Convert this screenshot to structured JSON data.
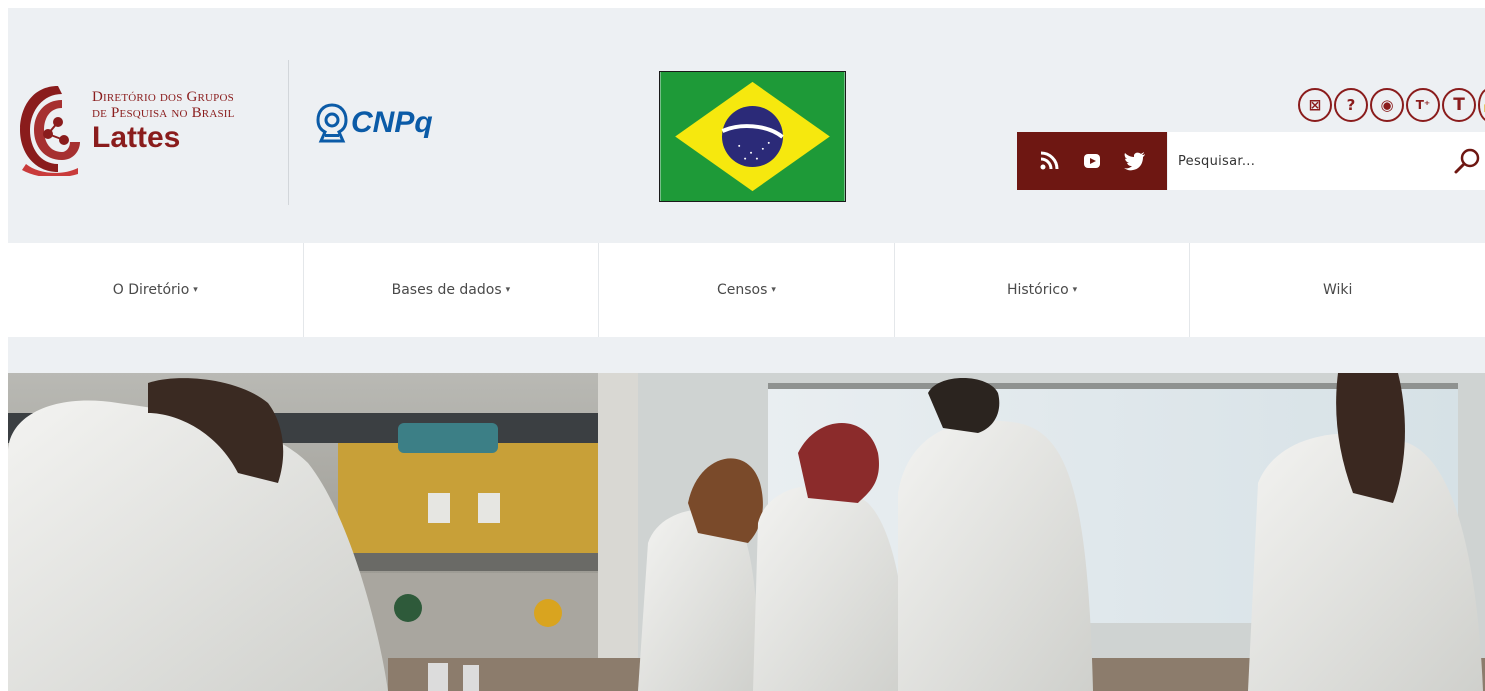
{
  "header": {
    "lattes_logo": {
      "line1": "Diretório dos Grupos",
      "line2": "de Pesquisa no Brasil",
      "line3": "Lattes"
    },
    "cnpq_logo": {
      "text": "CNPq"
    },
    "accessibility_icons": [
      "high-contrast-icon",
      "help-icon",
      "eye-icon",
      "font-increase-icon",
      "font-decrease-icon",
      "lock-icon"
    ],
    "social": [
      "rss-icon",
      "youtube-icon",
      "twitter-icon"
    ],
    "search": {
      "placeholder": "Pesquisar..."
    },
    "colors": {
      "brand_red": "#8a1c1c",
      "social_bg": "#6e1712",
      "cnpq_blue": "#0b5ba7",
      "header_bg": "#edf0f3"
    }
  },
  "nav": {
    "items": [
      {
        "label": "O Diretório",
        "has_dropdown": true
      },
      {
        "label": "Bases de dados",
        "has_dropdown": true
      },
      {
        "label": "Censos",
        "has_dropdown": true
      },
      {
        "label": "Histórico",
        "has_dropdown": true
      },
      {
        "label": "Wiki",
        "has_dropdown": false
      }
    ],
    "caret": "▾"
  },
  "hero": {
    "image": "laboratory-researchers-photo"
  }
}
